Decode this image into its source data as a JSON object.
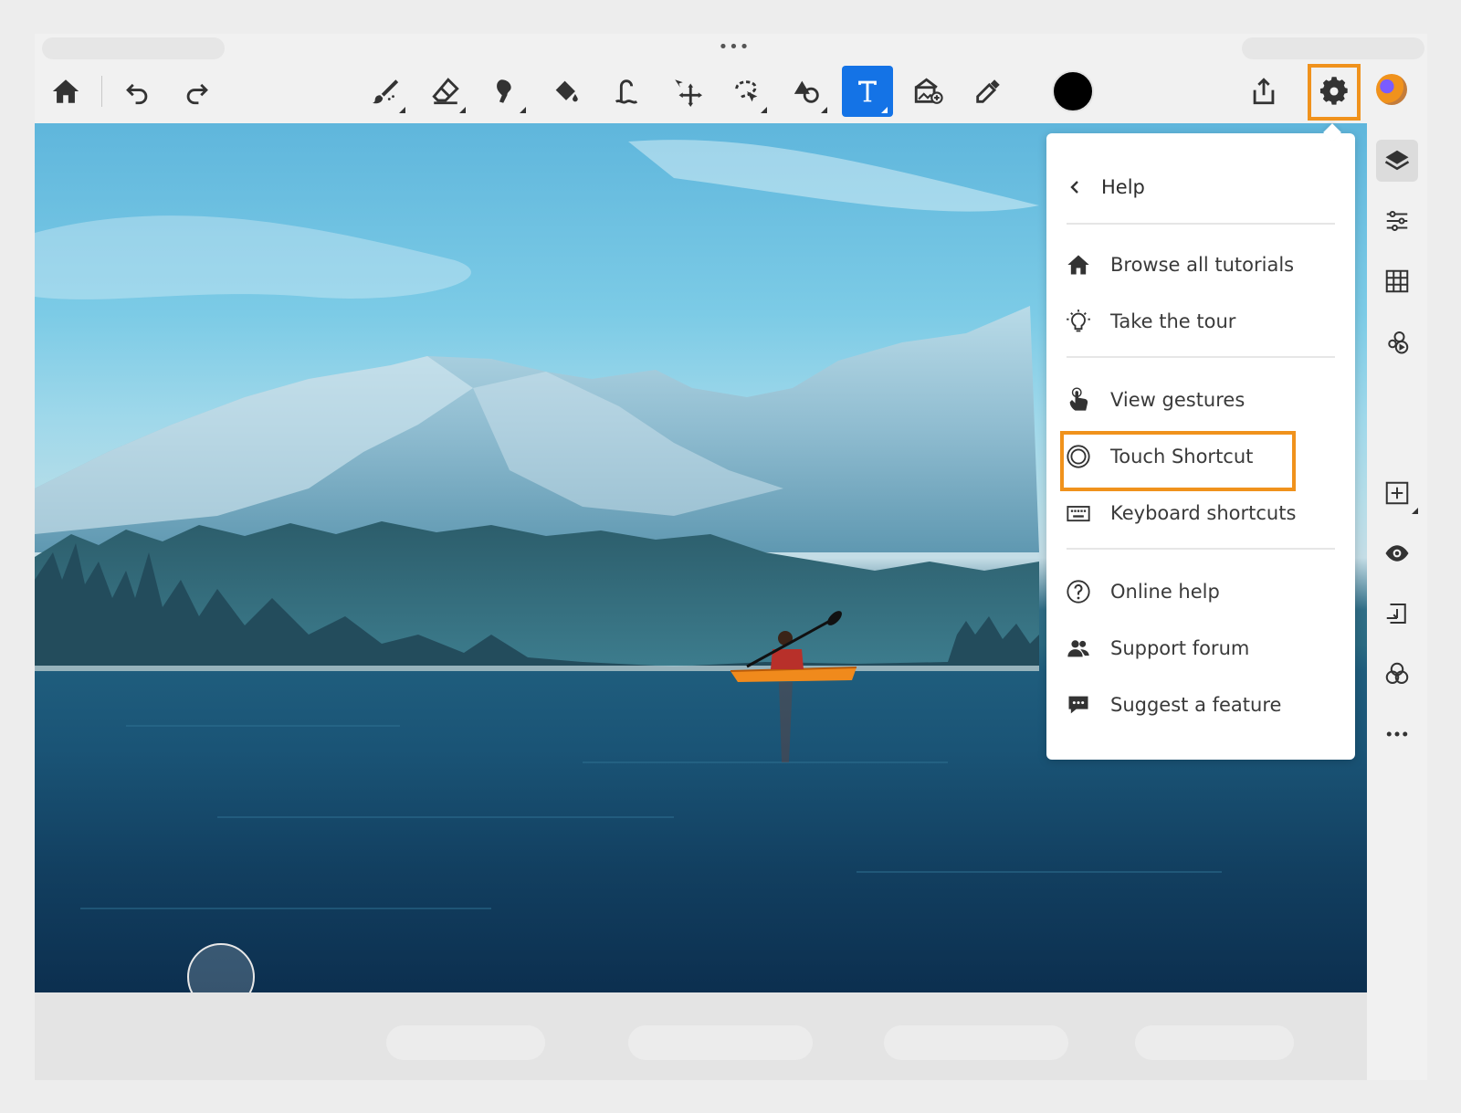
{
  "statusbar": {
    "multitask_dots": "•••"
  },
  "toolbar": {
    "left": [
      {
        "name": "home-button",
        "icon": "home-icon"
      },
      {
        "name": "undo-button",
        "icon": "undo-icon"
      },
      {
        "name": "redo-button",
        "icon": "redo-icon"
      }
    ],
    "tools": [
      {
        "name": "brush-tool",
        "icon": "brush-icon",
        "active": false
      },
      {
        "name": "eraser-tool",
        "icon": "eraser-icon",
        "active": false
      },
      {
        "name": "smudge-tool",
        "icon": "smudge-icon",
        "active": false
      },
      {
        "name": "fill-tool",
        "icon": "paint-bucket-icon",
        "active": false
      },
      {
        "name": "liquify-tool",
        "icon": "liquify-icon",
        "active": false
      },
      {
        "name": "transform-tool",
        "icon": "move-icon",
        "active": false
      },
      {
        "name": "selection-tool",
        "icon": "lasso-icon",
        "active": false
      },
      {
        "name": "shape-tool",
        "icon": "shapes-icon",
        "active": false
      },
      {
        "name": "text-tool",
        "icon": "text-icon",
        "label": "T",
        "active": true
      },
      {
        "name": "place-image-tool",
        "icon": "add-image-icon",
        "active": false
      },
      {
        "name": "eyedropper-tool",
        "icon": "eyedropper-icon",
        "active": false
      }
    ],
    "current_color": "#000000",
    "right": [
      {
        "name": "share-button",
        "icon": "share-icon"
      },
      {
        "name": "settings-button",
        "icon": "gear-icon",
        "highlighted": true
      },
      {
        "name": "profile-avatar",
        "icon": "avatar-icon"
      }
    ]
  },
  "right_panel": [
    {
      "name": "layers-button",
      "icon": "layers-icon",
      "active": true
    },
    {
      "name": "adjustments-button",
      "icon": "sliders-icon"
    },
    {
      "name": "grid-button",
      "icon": "grid-icon"
    },
    {
      "name": "livestream-button",
      "icon": "livestream-icon"
    },
    {
      "name": "add-layer-button",
      "icon": "plus-square-icon"
    },
    {
      "name": "visibility-button",
      "icon": "eye-icon"
    },
    {
      "name": "merge-down-button",
      "icon": "merge-down-icon"
    },
    {
      "name": "blend-mode-button",
      "icon": "blend-icon"
    },
    {
      "name": "more-button",
      "icon": "more-icon"
    }
  ],
  "help_menu": {
    "header": "Help",
    "items": [
      {
        "label": "Browse all tutorials",
        "icon": "home-icon"
      },
      {
        "label": "Take the tour",
        "icon": "lightbulb-icon"
      },
      {
        "label": "View gestures",
        "icon": "gesture-icon"
      },
      {
        "label": "Touch Shortcut",
        "icon": "touch-shortcut-icon",
        "highlighted": true
      },
      {
        "label": "Keyboard shortcuts",
        "icon": "keyboard-icon"
      },
      {
        "label": "Online help",
        "icon": "question-icon"
      },
      {
        "label": "Support forum",
        "icon": "people-icon"
      },
      {
        "label": "Suggest a feature",
        "icon": "speech-bubble-icon"
      }
    ]
  },
  "highlight_color": "#f0921c",
  "accent_color": "#1473e6"
}
